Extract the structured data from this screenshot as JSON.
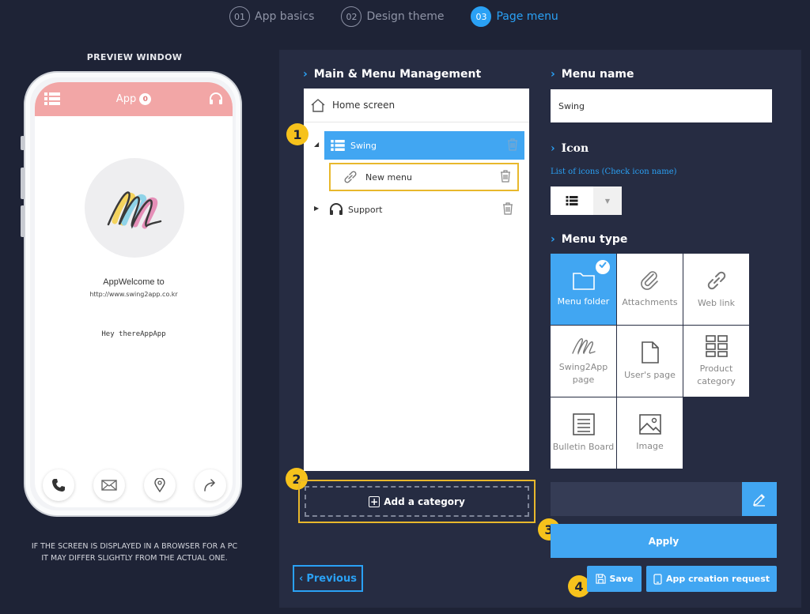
{
  "steps": [
    {
      "num": "01",
      "label": "App basics"
    },
    {
      "num": "02",
      "label": "Design theme"
    },
    {
      "num": "03",
      "label": "Page menu",
      "active": true
    }
  ],
  "preview": {
    "title": "PREVIEW WINDOW",
    "app_title": "App",
    "badge": "0",
    "welcome": "AppWelcome to",
    "url": "http://www.swing2app.co.kr",
    "hey": "Hey thereAppApp",
    "note_line1": "IF THE SCREEN IS DISPLAYED IN A BROWSER FOR A PC",
    "note_line2": "IT MAY DIFFER SLIGHTLY FROM THE ACTUAL ONE."
  },
  "menu_management": {
    "title": "Main & Menu Management",
    "home": "Home screen",
    "items": [
      {
        "label": "Swing"
      },
      {
        "label": "New menu"
      },
      {
        "label": "Support"
      }
    ],
    "add_category": "Add a category"
  },
  "menu_name": {
    "title": "Menu name",
    "value": "Swing"
  },
  "icon": {
    "title": "Icon",
    "hint": "List of icons (Check icon name)"
  },
  "menu_type": {
    "title": "Menu type",
    "options": [
      {
        "label": "Menu folder"
      },
      {
        "label": "Attachments"
      },
      {
        "label": "Web link"
      },
      {
        "label": "Swing2App page"
      },
      {
        "label": "User's page"
      },
      {
        "label": "Product category"
      },
      {
        "label": "Bulletin Board"
      },
      {
        "label": "Image"
      }
    ]
  },
  "markers": [
    "1",
    "2",
    "3",
    "4"
  ],
  "buttons": {
    "previous": "Previous",
    "apply": "Apply",
    "save": "Save",
    "app_request": "App creation request"
  },
  "colors": {
    "accent": "#41a6f2",
    "highlight": "#e8b82c",
    "marker": "#f6c21c",
    "background": "#1e2336",
    "app_bar": "#f2a6a6"
  }
}
